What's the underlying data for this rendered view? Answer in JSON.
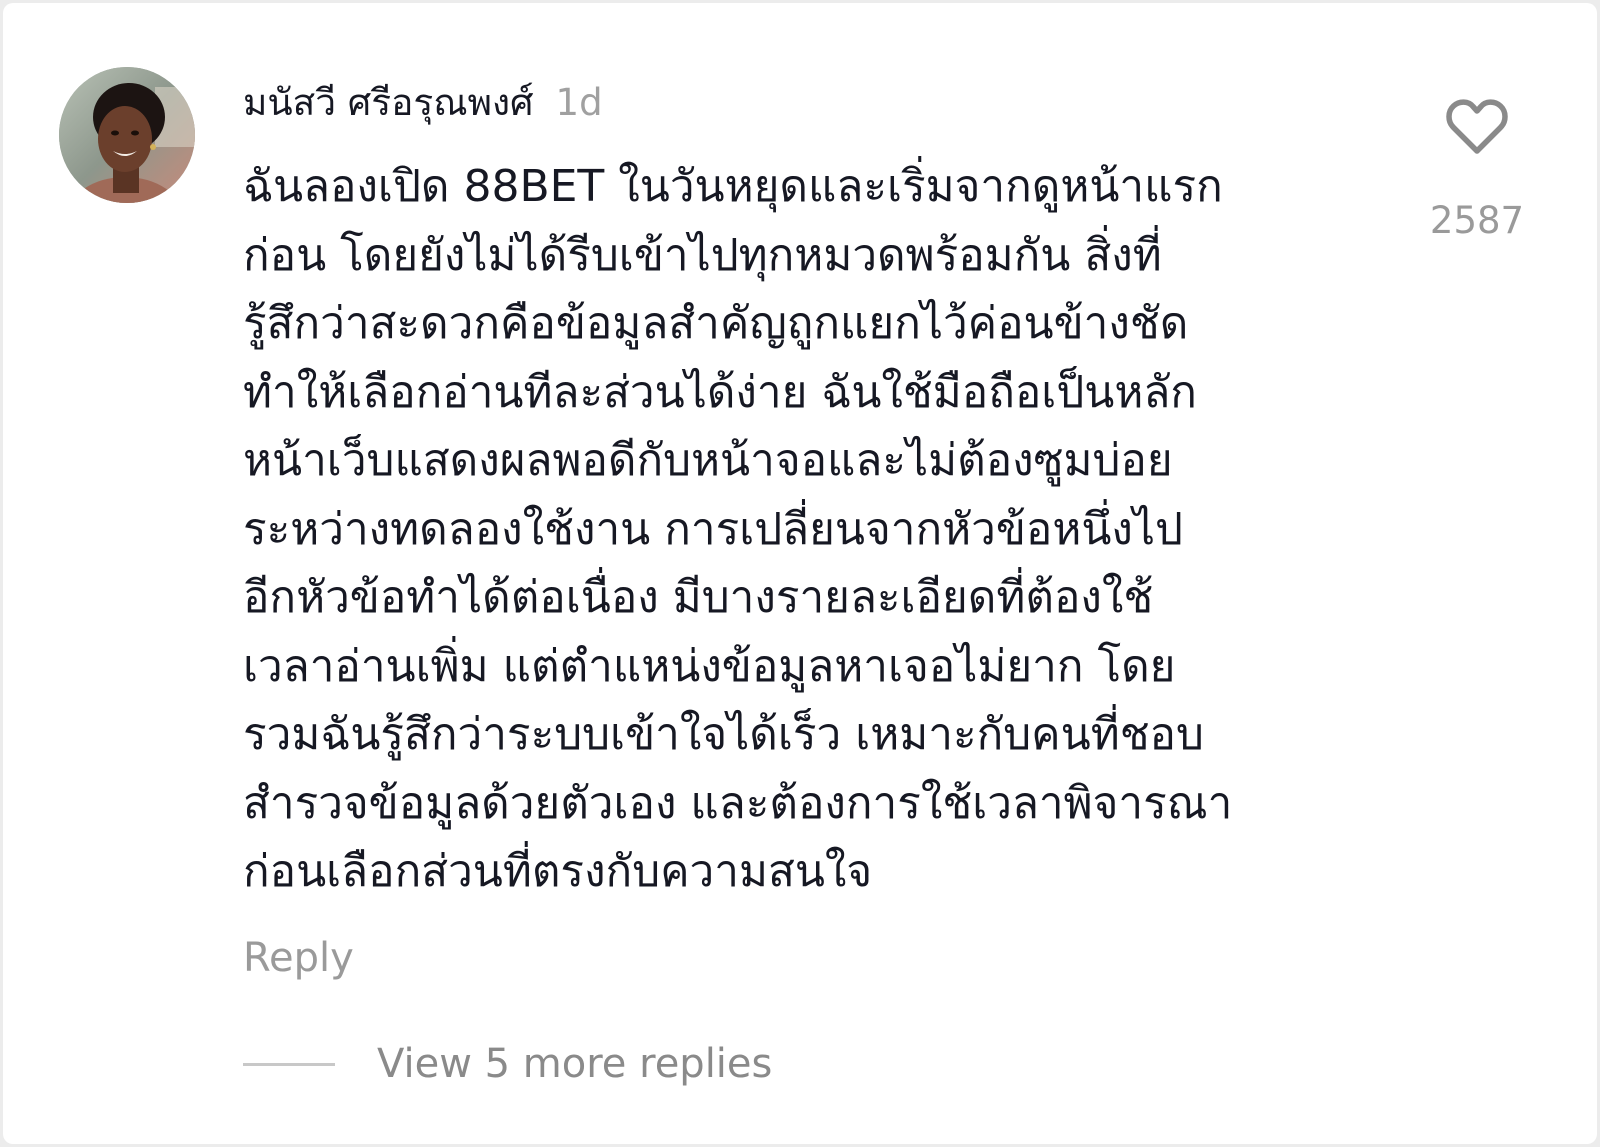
{
  "comment": {
    "username": "มนัสวี ศรีอรุณพงศ์",
    "time": "1d",
    "text": "ฉันลองเปิด 88BET ในวันหยุดและเริ่มจากดูหน้าแรก\nก่อน โดยยังไม่ได้รีบเข้าไปทุกหมวดพร้อมกัน สิ่งที่\nรู้สึกว่าสะดวกคือข้อมูลสำคัญถูกแยกไว้ค่อนข้างชัด\nทำให้เลือกอ่านทีละส่วนได้ง่าย ฉันใช้มือถือเป็นหลัก\nหน้าเว็บแสดงผลพอดีกับหน้าจอและไม่ต้องซูมบ่อย\nระหว่างทดลองใช้งาน การเปลี่ยนจากหัวข้อหนึ่งไป\nอีกหัวข้อทำได้ต่อเนื่อง มีบางรายละเอียดที่ต้องใช้\nเวลาอ่านเพิ่ม แต่ตำแหน่งข้อมูลหาเจอไม่ยาก โดย\nรวมฉันรู้สึกว่าระบบเข้าใจได้เร็ว เหมาะกับคนที่ชอบ\nสำรวจข้อมูลด้วยตัวเอง และต้องการใช้เวลาพิจารณา\nก่อนเลือกส่วนที่ตรงกับความสนใจ",
    "reply_label": "Reply",
    "like_icon": "heart-outline-icon",
    "like_count": "2587",
    "more_replies_label": "View 5 more replies"
  },
  "colors": {
    "text_primary": "#161823",
    "text_secondary": "#9a9a9a",
    "background": "#ffffff"
  }
}
